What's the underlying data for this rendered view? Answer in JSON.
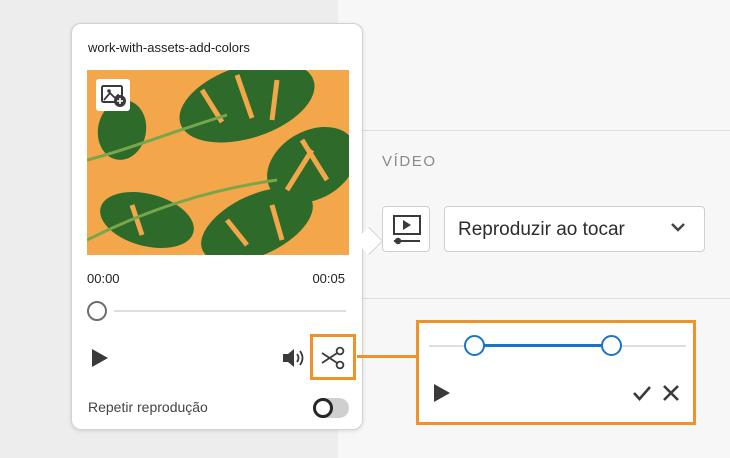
{
  "card": {
    "title": "work-with-assets-add-colors",
    "time_start": "00:00",
    "time_end": "00:05",
    "playback_position": 0.0,
    "repeat_label": "Repetir reprodução",
    "repeat_enabled": false,
    "icons": {
      "add_image": "image-add-icon",
      "play": "play-icon",
      "volume": "volume-icon",
      "trim": "scissors-icon"
    }
  },
  "panel": {
    "section_title": "VÍDEO",
    "video_icon": "video-player-icon",
    "playback_mode": "Reproduzir ao tocar",
    "dropdown_icon": "chevron-down-icon"
  },
  "callout": {
    "trim_start": 0.18,
    "trim_end": 0.72,
    "icons": {
      "play": "play-icon",
      "confirm": "checkmark-icon",
      "discard": "close-icon"
    }
  },
  "colors": {
    "highlight": "#f0922a",
    "trim_accent": "#1a73c9",
    "thumbnail_background": "#f4a64a",
    "leaf": "#2e6b2a"
  }
}
